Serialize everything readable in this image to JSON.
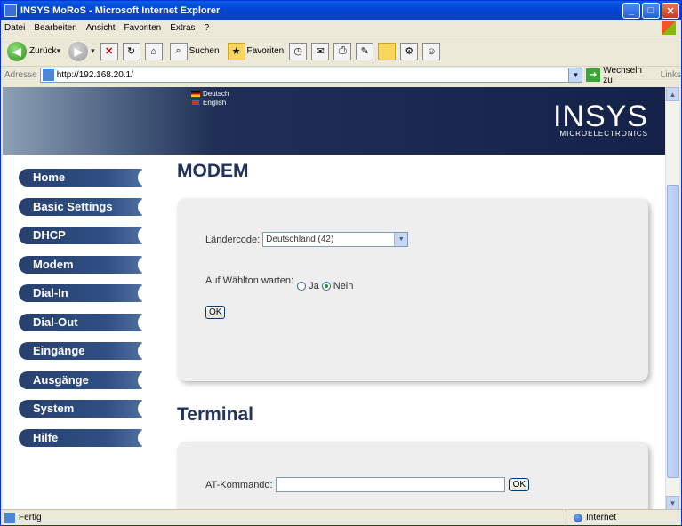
{
  "window": {
    "title": "INSYS MoRoS - Microsoft Internet Explorer"
  },
  "menu": [
    "Datei",
    "Bearbeiten",
    "Ansicht",
    "Favoriten",
    "Extras",
    "?"
  ],
  "toolbar": {
    "back": "Zurück",
    "search": "Suchen",
    "favorites": "Favoriten"
  },
  "address": {
    "label": "Adresse",
    "url": "http://192.168.20.1/",
    "go": "Wechseln zu",
    "links": "Links"
  },
  "banner": {
    "lang_de": "Deutsch",
    "lang_en": "English",
    "logo": "INSYS",
    "logo_sub": "MICROELECTRONICS"
  },
  "nav": [
    "Home",
    "Basic Settings",
    "DHCP",
    "Modem",
    "Dial-In",
    "Dial-Out",
    "Eingänge",
    "Ausgänge",
    "System",
    "Hilfe"
  ],
  "modem": {
    "title": "MODEM",
    "country_label": "Ländercode:",
    "country_value": "Deutschland (42)",
    "wait_label": "Auf Wählton warten:",
    "opt_yes": "Ja",
    "opt_no": "Nein",
    "selected": "Nein",
    "ok": "OK"
  },
  "terminal": {
    "title": "Terminal",
    "at_label": "AT-Kommando:",
    "ok": "OK"
  },
  "status": {
    "left": "Fertig",
    "zone": "Internet"
  }
}
